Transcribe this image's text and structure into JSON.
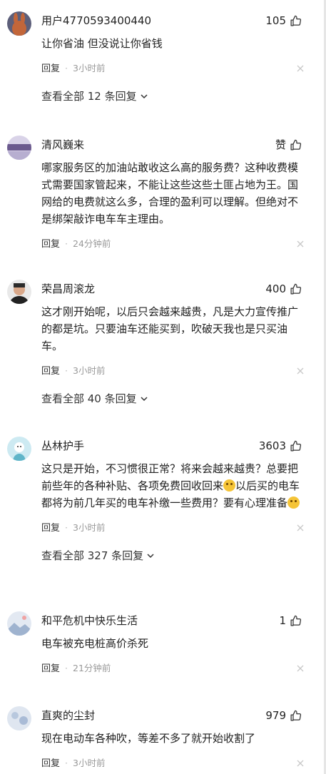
{
  "comments": [
    {
      "username": "用户4770593400440",
      "likes": "105",
      "text": "让你省油 但没说让你省钱",
      "reply_label": "回复",
      "separator": "·",
      "time": "3小时前",
      "view_all": "查看全部 12 条回复"
    },
    {
      "username": "清风巍来",
      "likes": "赞",
      "text": "哪家服务区的加油站敢收这么高的服务费？这种收费模式需要国家管起来，不能让这些这些土匪占地为王。国网给的电费就这么多，合理的盈利可以理解。但绝对不是绑架敲诈电车车主理由。",
      "reply_label": "回复",
      "separator": "·",
      "time": "24分钟前"
    },
    {
      "username": "荣昌周滚龙",
      "likes": "400",
      "text": "这才刚开始呢，以后只会越来越贵，凡是大力宣传推广的都是坑。只要油车还能买到，吹破天我也是只买油车。",
      "reply_label": "回复",
      "separator": "·",
      "time": "3小时前",
      "view_all": "查看全部 40 条回复"
    },
    {
      "username": "丛林护手",
      "likes": "3603",
      "text_part1": "这只是开始，不习惯很正常？将来会越来越贵？总要把前些年的各种补贴、各项免费回收回来",
      "text_part2": "以后买的电车都将为前几年买的电车补缴一些费用？要有心理准备",
      "emoji1": "laughing-tears-emoji",
      "emoji2": "smirk-emoji",
      "reply_label": "回复",
      "separator": "·",
      "time": "3小时前",
      "view_all": "查看全部 327 条回复"
    },
    {
      "username": "和平危机中快乐生活",
      "likes": "1",
      "text": "电车被充电桩高价杀死",
      "reply_label": "回复",
      "separator": "·",
      "time": "21分钟前"
    },
    {
      "username": "直爽的尘封",
      "likes": "979",
      "text": "现在电动车各种吹，等差不多了就开始收割了",
      "reply_label": "回复",
      "separator": "·",
      "time": "3小时前"
    }
  ],
  "icons": {
    "like": "thumbs-up-icon",
    "close": "close-icon",
    "expand": "chevron-down-icon"
  },
  "colors": {
    "text": "#222222",
    "meta": "#999999",
    "separator": "#b5b5b5"
  }
}
